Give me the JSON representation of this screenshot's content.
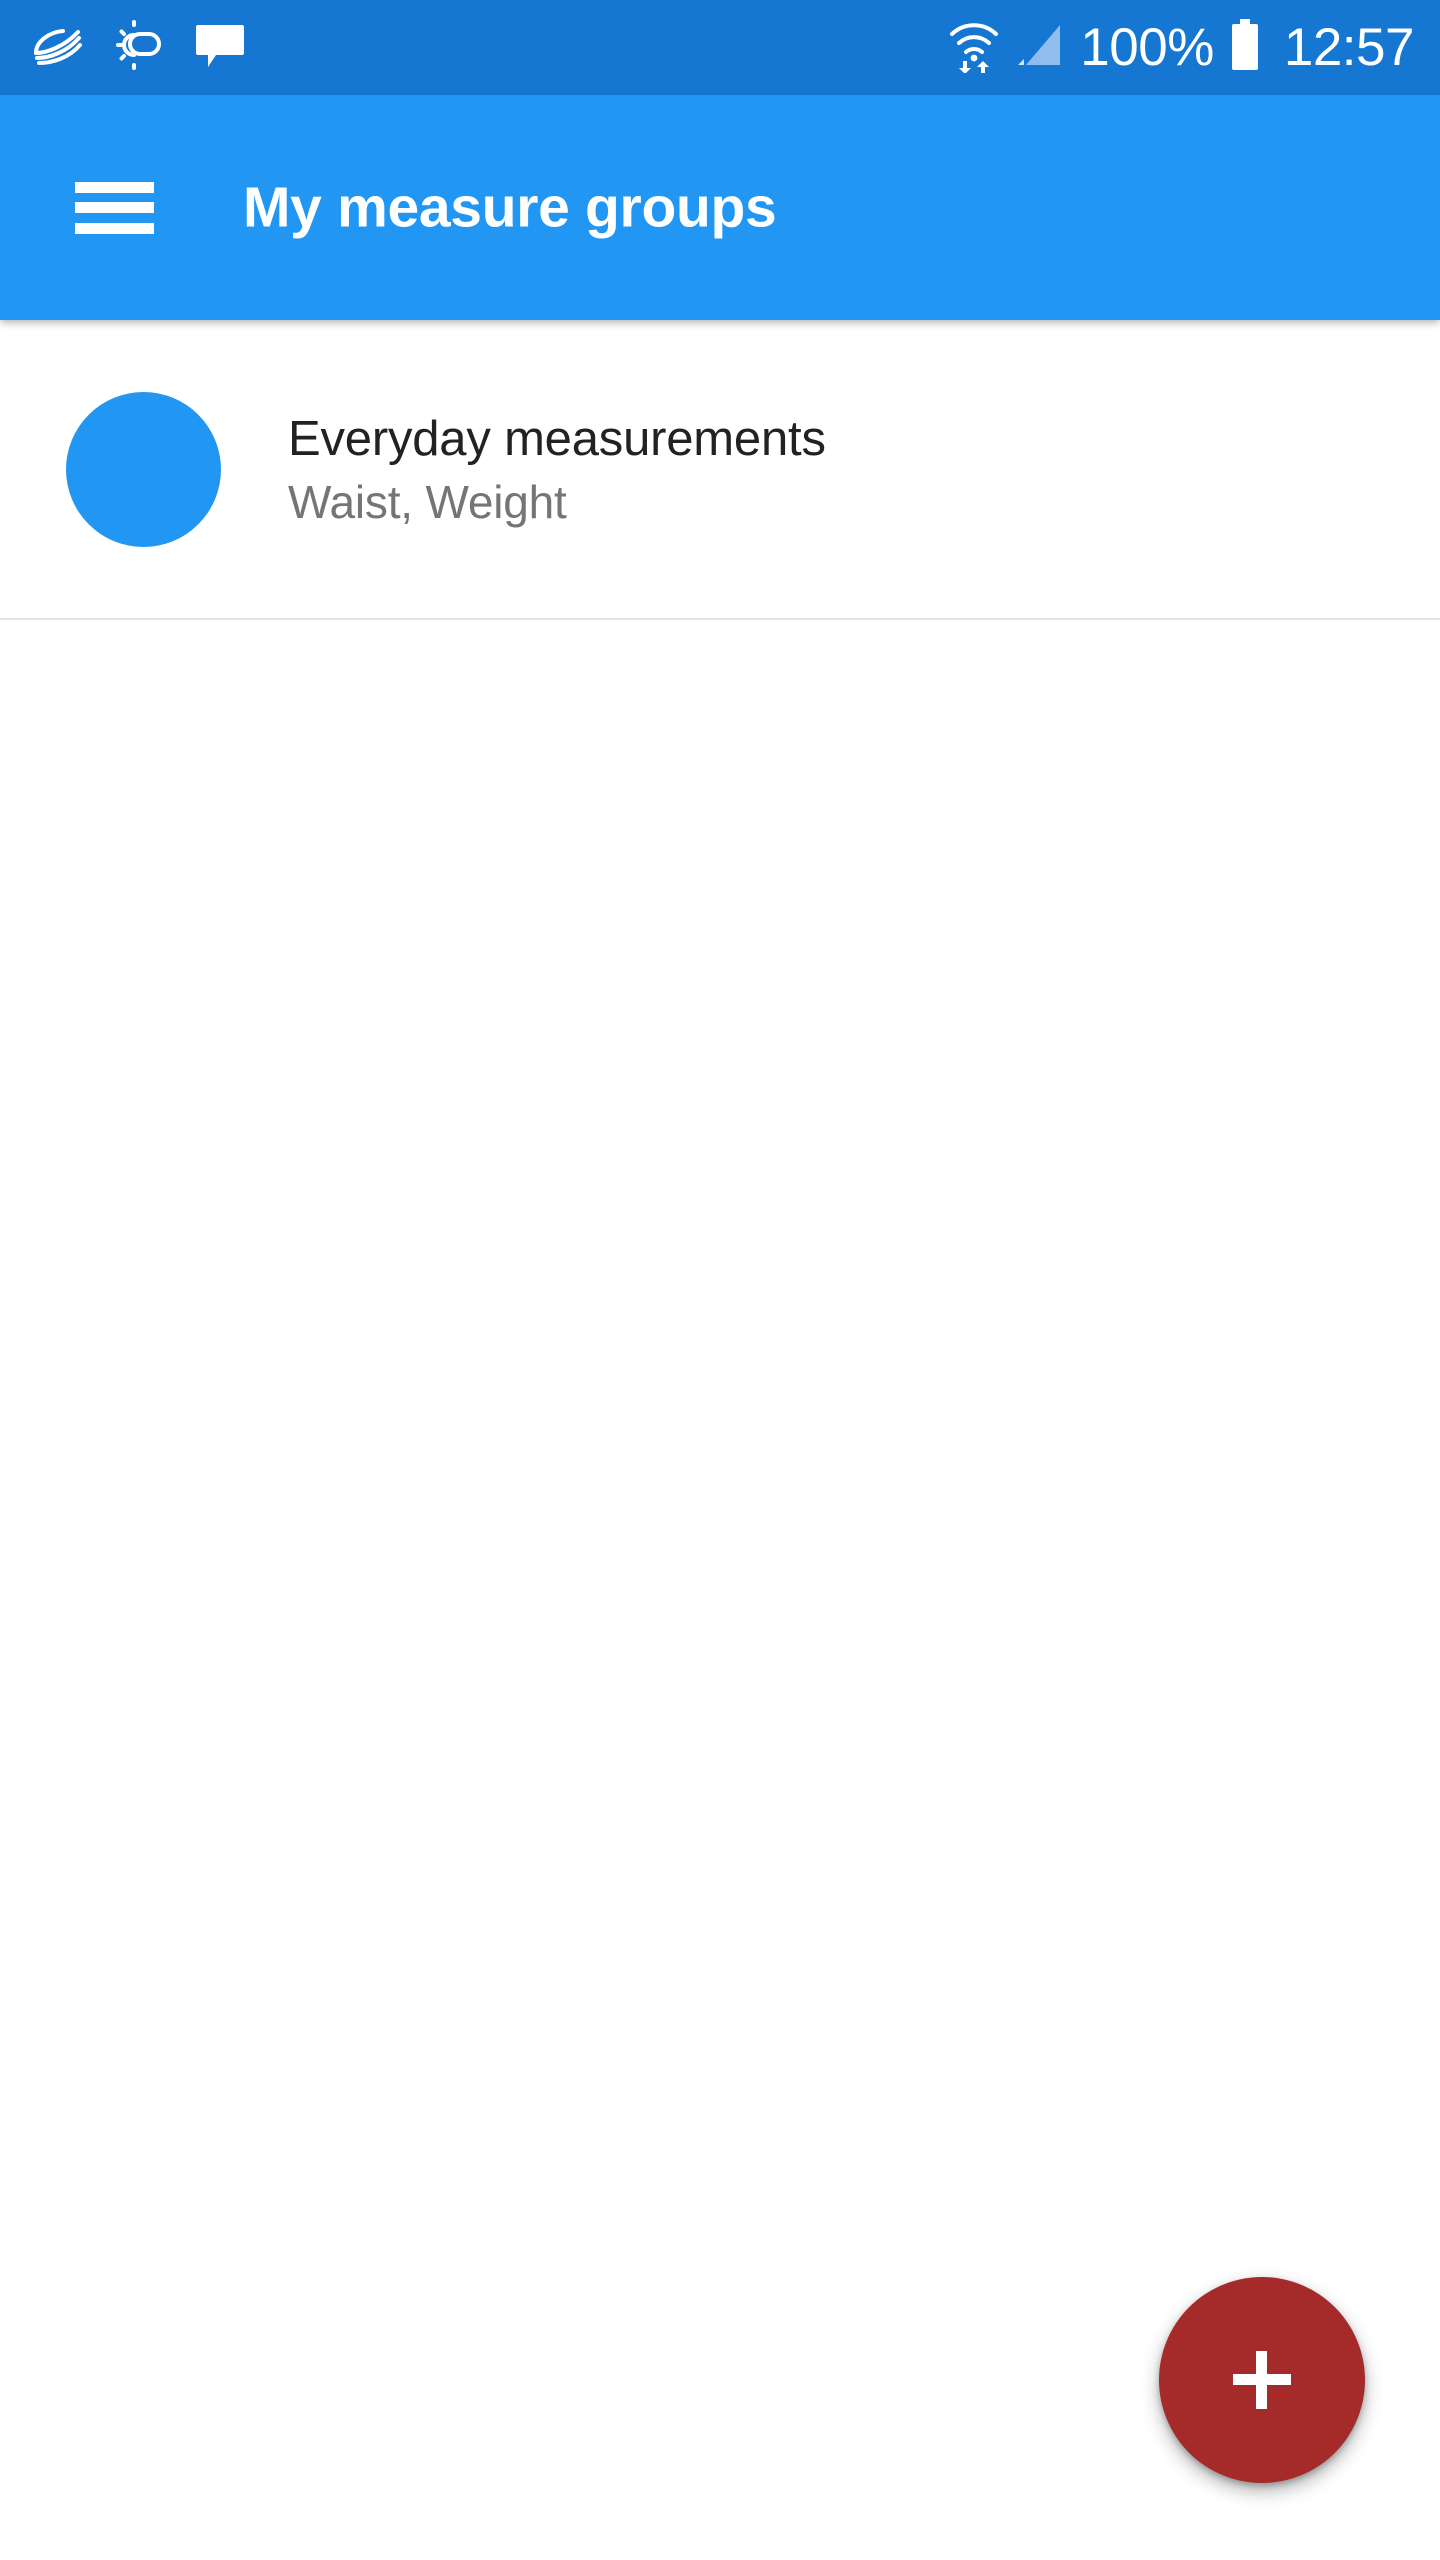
{
  "status_bar": {
    "background_color": "#1577d2",
    "left_icons": [
      {
        "name": "swiftkey-keyboard-icon",
        "label": "SwiftKey keyboard"
      },
      {
        "name": "weather-partly-sunny-icon",
        "label": "Weather"
      },
      {
        "name": "message-bubble-icon",
        "label": "New message"
      }
    ],
    "right_icons": [
      {
        "name": "wifi-data-transfer-icon",
        "label": "Wi-Fi"
      },
      {
        "name": "cellular-signal-icon",
        "label": "Mobile signal"
      },
      {
        "name": "battery-full-icon",
        "label": "Battery"
      }
    ],
    "battery_percent": "100%",
    "clock": "12:57"
  },
  "app_bar": {
    "background_color": "#2196f3",
    "menu_icon": "hamburger-menu-icon",
    "title": "My measure groups"
  },
  "list": {
    "items": [
      {
        "title": "Everyday measurements",
        "subtitle": "Waist, Weight",
        "avatar_color": "#2196f3"
      }
    ]
  },
  "fab": {
    "icon": "plus-icon",
    "label": "+",
    "background_color": "#a52a2a"
  }
}
